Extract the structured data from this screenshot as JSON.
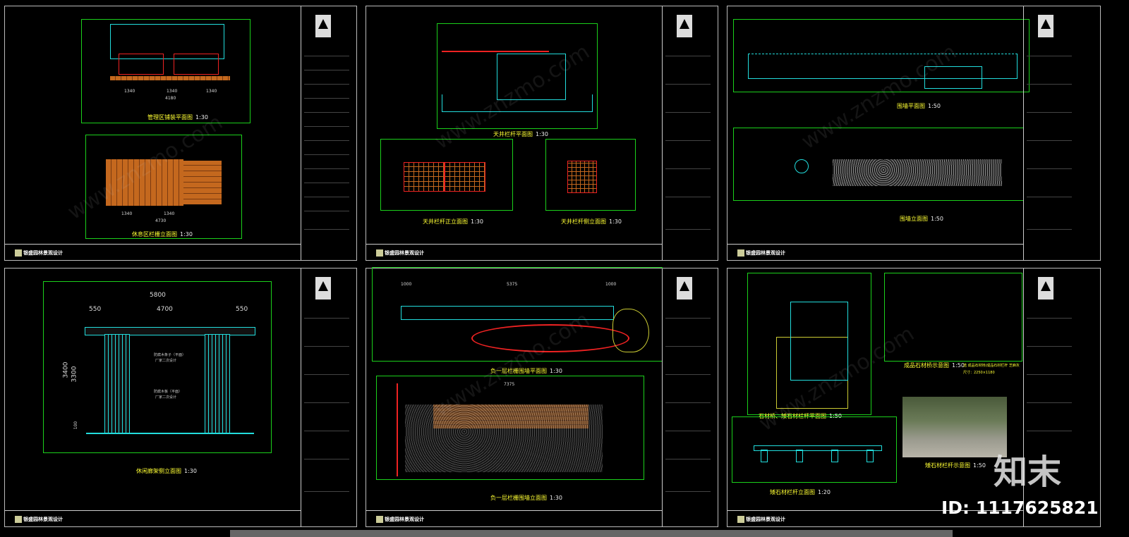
{
  "sheets": {
    "s1": {
      "firm": "银盛园林景观设计",
      "captions": {
        "plan": "管理区铺装平面图",
        "elev": "休息区栏栅立面图"
      },
      "scale": "1:30",
      "dims": {
        "a": "1340",
        "b": "1340",
        "c": "1340",
        "d": "4180",
        "e": "1340",
        "f": "1340",
        "g": "4730"
      }
    },
    "s2": {
      "captions": {
        "plan": "天井栏杆平面图",
        "front": "天井栏杆正立面图",
        "side": "天井栏杆侧立面图"
      },
      "scale": "1:30"
    },
    "s3": {
      "captions": {
        "plan": "围墙平面图",
        "elev": "围墙立面图"
      },
      "scale": "1:50"
    },
    "s4": {
      "firm": "银盛园林景观设计",
      "caption": "休闲廊架侧立面图",
      "scale": "1:30",
      "dims": {
        "total": "5800",
        "left": "550",
        "mid": "4700",
        "right": "550",
        "h1": "3400",
        "h2": "3300",
        "base": "100"
      },
      "notes": {
        "n1": "防腐木条子（平面）",
        "n2": "厂家二次设计",
        "n3": "防腐木板（平面）",
        "n4": "厂家二次设计"
      }
    },
    "s5": {
      "captions": {
        "plan": "负一层栏栅围墙平面图",
        "elev": "负一层栏栅围墙立面图"
      },
      "scale": "1:30",
      "dims": {
        "a": "1000",
        "b": "5375",
        "c": "1000",
        "d": "7375"
      }
    },
    "s6": {
      "captions": {
        "plan": "石材桥、矮石材栏杆平面图",
        "sample": "成品石材桥示意图",
        "low": "矮石材栏杆立面图",
        "photo": "矮石材栏杆示意图"
      },
      "scales": {
        "plan": "1:50",
        "sample": "1:50",
        "low": "1:20",
        "photo": "1:50"
      },
      "sample_note": "选 成品石材桥/成品石材栏杆  芝麻灰",
      "sample_size": "尺寸：2250×1180"
    }
  },
  "watermark": {
    "site": "www.znzmo.com",
    "brand": "知末",
    "id": "ID: 1117625821"
  }
}
